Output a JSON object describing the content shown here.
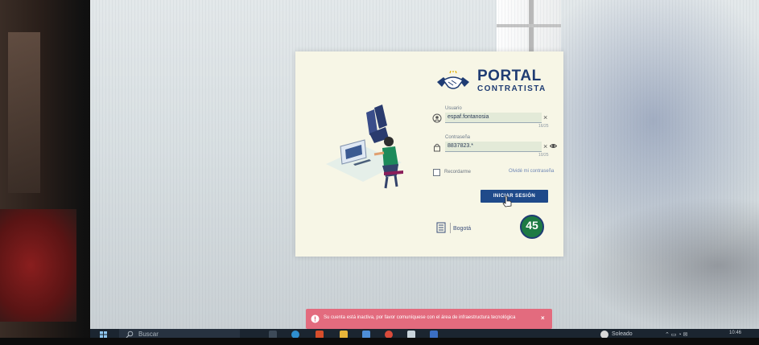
{
  "portal": {
    "brand_title": "PORTAL",
    "brand_subtitle": "CONTRATISTA"
  },
  "form": {
    "username_label": "Usuario",
    "username_value": "espaf.fontanosia",
    "username_counter": "16/25",
    "password_label": "Contraseña",
    "password_value": "8837823.*",
    "password_counter": "10/25",
    "remember_label": "Recordarme",
    "forgot_label": "Olvidé mi contraseña",
    "submit_label": "INICIAR SESIÓN"
  },
  "footer": {
    "partner_name": "Bogotá",
    "badge_number": "45"
  },
  "toast": {
    "message": "Su cuenta está inactiva, por favor comuníquese con el área de infraestructura tecnológica"
  },
  "taskbar": {
    "search_placeholder": "Buscar",
    "weather_text": "Soleado",
    "clock_text": "10:46"
  },
  "colors": {
    "brand_blue": "#1f3c73",
    "button_blue": "#1f4a8a",
    "toast_red": "#e36b7e",
    "card_bg": "#f7f6e6",
    "badge_green": "#1d7a43"
  },
  "icons": {
    "user_field": "user-icon",
    "password_field": "lock-icon",
    "show_password": "eye-icon",
    "clear": "close-icon",
    "toast": "warning-icon",
    "start": "windows-start-icon",
    "search": "search-icon"
  }
}
